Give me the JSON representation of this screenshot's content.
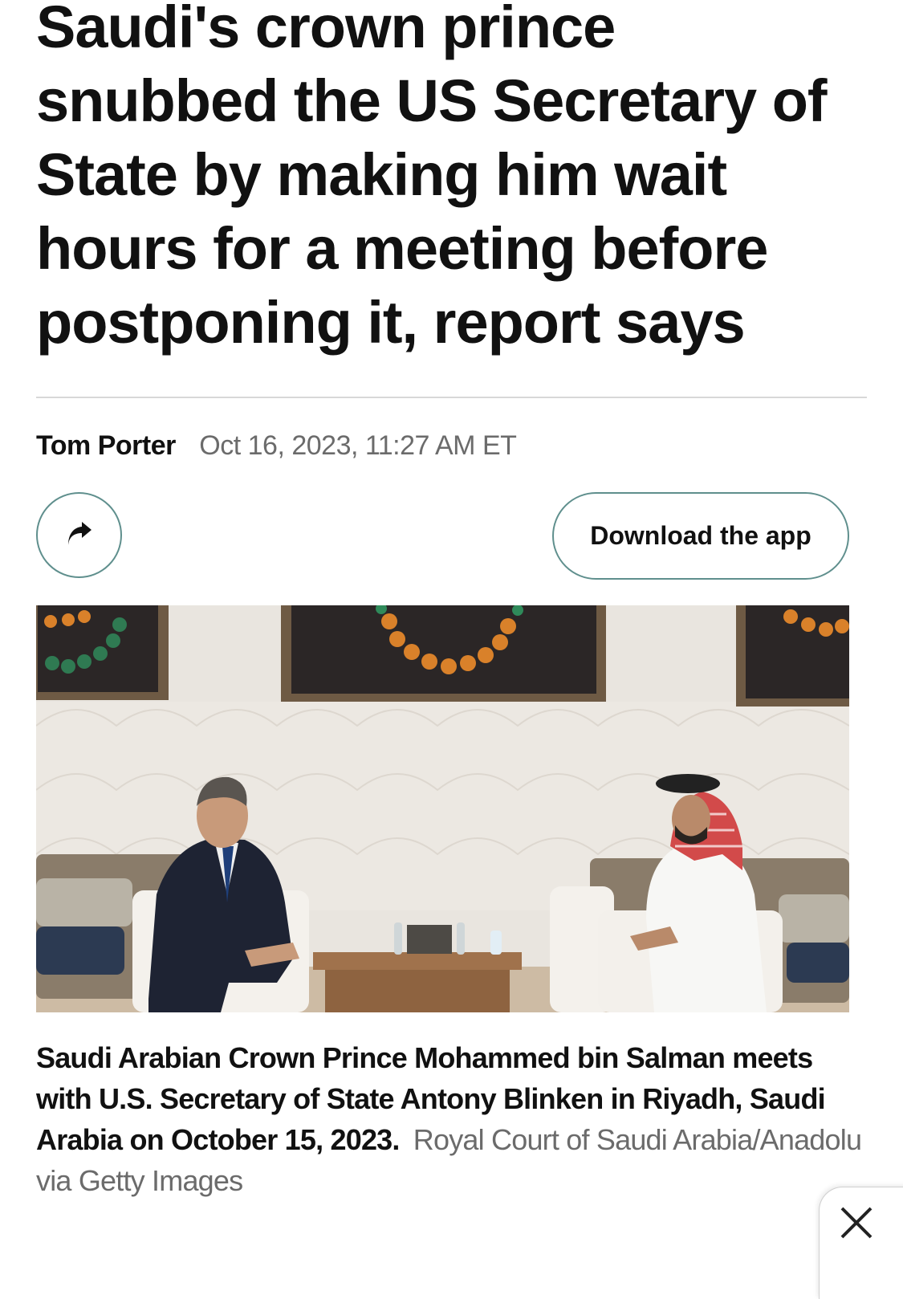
{
  "article": {
    "headline": "Saudi's crown prince snubbed the US Secretary of State by making him wait hours for a meeting before postponing it, report says",
    "author": "Tom Porter",
    "date": "Oct 16, 2023, 11:27 AM ET"
  },
  "actions": {
    "share_icon": "share-arrow-icon",
    "download_label": "Download the app"
  },
  "photo": {
    "caption": "Saudi Arabian Crown Prince Mohammed bin Salman meets with U.S. Secretary of State Antony Blinken in Riyadh, Saudi Arabia on October 15, 2023.",
    "credit": "Royal Court of Saudi Arabia/Anadolu via Getty Images"
  },
  "overlay": {
    "close_icon": "close-icon"
  },
  "colors": {
    "button_border": "#5f8f8d",
    "headline": "#111111",
    "muted": "#6b6b6b",
    "divider": "#d8d8d8"
  }
}
